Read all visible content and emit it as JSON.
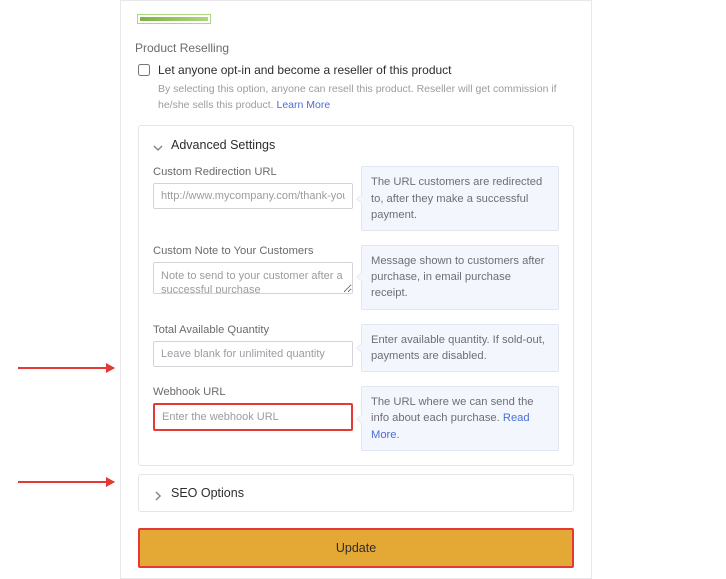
{
  "reselling": {
    "section_label": "Product Reselling",
    "checkbox_label": "Let anyone opt-in and become a reseller of this product",
    "sub_text": "By selecting this option, anyone can resell this product. Reseller will get commission if he/she sells this product. ",
    "learn_more": "Learn More"
  },
  "advanced": {
    "title": "Advanced Settings",
    "redirect": {
      "label": "Custom Redirection URL",
      "placeholder": "http://www.mycompany.com/thank-you.html",
      "hint": "The URL customers are redirected to, after they make a successful payment."
    },
    "note": {
      "label": "Custom Note to Your Customers",
      "placeholder": "Note to send to your customer after a successful purchase",
      "hint": "Message shown to customers after purchase, in email purchase receipt."
    },
    "qty": {
      "label": "Total Available Quantity",
      "placeholder": "Leave blank for unlimited quantity",
      "hint": "Enter available quantity. If sold-out, payments are disabled."
    },
    "webhook": {
      "label": "Webhook URL",
      "placeholder": "Enter the webhook URL",
      "hint_prefix": "The URL where we can send the info about each purchase. ",
      "read_more": "Read More."
    }
  },
  "seo": {
    "title": "SEO Options"
  },
  "footer": {
    "update": "Update"
  }
}
